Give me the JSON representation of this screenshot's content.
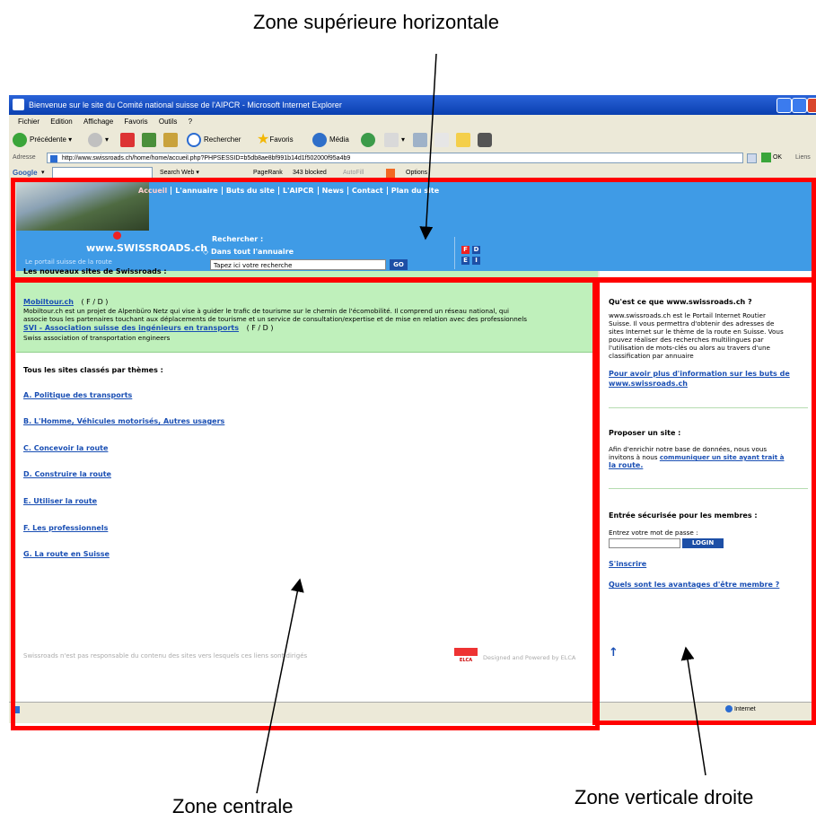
{
  "annotations": {
    "top": "Zone supérieure horizontale",
    "center": "Zone centrale",
    "right": "Zone verticale droite"
  },
  "browser": {
    "title": "Bienvenue sur le site du Comité national suisse de l'AIPCR - Microsoft Internet Explorer",
    "menu": [
      "Fichier",
      "Edition",
      "Affichage",
      "Favoris",
      "Outils",
      "?"
    ],
    "toolbar": {
      "back": "Précédente",
      "search": "Rechercher",
      "favorites": "Favoris",
      "media": "Média"
    },
    "address_label": "Adresse",
    "address": "http://www.swissroads.ch/home/home/accueil.php?PHPSESSID=b5db8ae8bf991b14d1f502000f95a4b9",
    "go": "OK",
    "links": "Liens",
    "googlebar": {
      "brand": "Google",
      "search_web": "Search Web",
      "pagerank": "PageRank",
      "blocked": "343 blocked",
      "autofill": "AutoFill",
      "options": "Options"
    },
    "status": "Internet"
  },
  "site": {
    "nav": [
      "Accueil",
      "L'annuaire",
      "Buts du site",
      "L'AIPCR",
      "News",
      "Contact",
      "Plan du site"
    ],
    "logo": "www.SWISSROADS.ch",
    "tagline": "Le portail suisse de la route",
    "search_label": "Rechercher :",
    "search_scope": "Dans tout l'annuaire",
    "search_placeholder": "Tapez ici votre recherche",
    "search_button": "GO",
    "lang": [
      "F",
      "D",
      "E",
      "I"
    ]
  },
  "content": {
    "new_sites_title": "Les nouveaux sites de Swissroads :",
    "new_sites": [
      {
        "name": "Mobiltour.ch",
        "lang": "( F / D )",
        "desc1": "Mobiltour.ch est un projet de Alpenbüro Netz qui vise à guider le trafic de tourisme sur le chemin de l'écomobilité. Il comprend un réseau national, qui",
        "desc2": "associe tous les partenaires touchant aux déplacements de tourisme et un service de consultation/expertise et de mise en relation avec des professionnels"
      },
      {
        "name": "SVI - Association suisse des ingénieurs en transports",
        "lang": "( F / D )",
        "desc1": "Swiss association of transportation engineers"
      }
    ],
    "themes_title": "Tous les sites classés par thèmes :",
    "themes": [
      "A. Politique des transports",
      "B. L'Homme, Véhicules motorisés, Autres usagers",
      "C. Concevoir la route",
      "D. Construire la route",
      "E. Utiliser la route",
      "F. Les professionnels",
      "G. La route en Suisse"
    ],
    "disclaimer": "Swissroads n'est pas responsable du contenu des sites vers lesquels ces liens sont dirigés",
    "credit_logo": "ELCA",
    "credit": "Designed and Powered by ELCA"
  },
  "sidebar": {
    "what_title": "Qu'est ce que www.swissroads.ch ?",
    "what_text": [
      "www.swissroads.ch est le Portail Internet Routier",
      "Suisse. Il vous permettra d'obtenir des adresses de",
      "sites Internet sur le thème de la route en Suisse. Vous",
      "pouvez réaliser des recherches multilingues par",
      "l'utilisation de mots-clés ou alors au travers d'une",
      "classification par annuaire"
    ],
    "more_link": [
      "Pour avoir plus d'information sur les buts de",
      "www.swissroads.ch"
    ],
    "propose_title": "Proposer un site :",
    "propose_text": [
      "Afin d'enrichir notre base de données, nous vous",
      "invitons à nous "
    ],
    "propose_link": [
      "communiquer un site ayant trait à",
      "la route."
    ],
    "login_title": "Entrée sécurisée pour les membres :",
    "password_label": "Entrez votre mot de passe :",
    "login_button": "LOGIN",
    "register": "S'inscrire",
    "benefits": "Quels sont les avantages d'être membre ?",
    "top_arrow": "↑"
  },
  "colors": {
    "highlight": "#ff0000",
    "header_blue": "#3f9be6",
    "news_green": "#bff0bb",
    "link": "#1a4fb4"
  }
}
